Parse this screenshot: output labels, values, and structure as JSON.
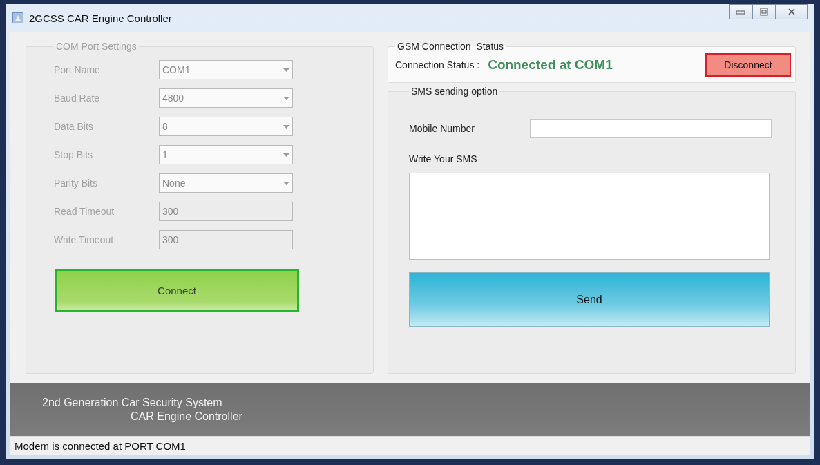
{
  "window": {
    "title": "2GCSS CAR Engine Controller"
  },
  "com_port_settings": {
    "title": "COM Port Settings",
    "disabled": true,
    "fields": [
      {
        "label": "Port Name",
        "value": "COM1",
        "kind": "dropdown"
      },
      {
        "label": "Baud Rate",
        "value": "4800",
        "kind": "dropdown"
      },
      {
        "label": "Data Bits",
        "value": "8",
        "kind": "dropdown"
      },
      {
        "label": "Stop Bits",
        "value": "1",
        "kind": "dropdown"
      },
      {
        "label": "Parity Bits",
        "value": "None",
        "kind": "dropdown"
      },
      {
        "label": "Read Timeout",
        "value": "300",
        "kind": "text"
      },
      {
        "label": "Write Timeout",
        "value": "300",
        "kind": "text"
      }
    ],
    "button": "Connect"
  },
  "gsm_status": {
    "title": "GSM Connection  Status",
    "label": "Connection Status :",
    "status": "Connected at COM1",
    "button": "Disconnect"
  },
  "sms": {
    "title": "SMS sending option",
    "mobile_label": "Mobile Number",
    "message_label": "Write Your SMS",
    "button": "Send"
  },
  "banner": {
    "line_1": "2nd Generation Car Security System",
    "line_2": "CAR Engine Controller"
  },
  "status_bar": "Modem is connected at PORT COM1"
}
